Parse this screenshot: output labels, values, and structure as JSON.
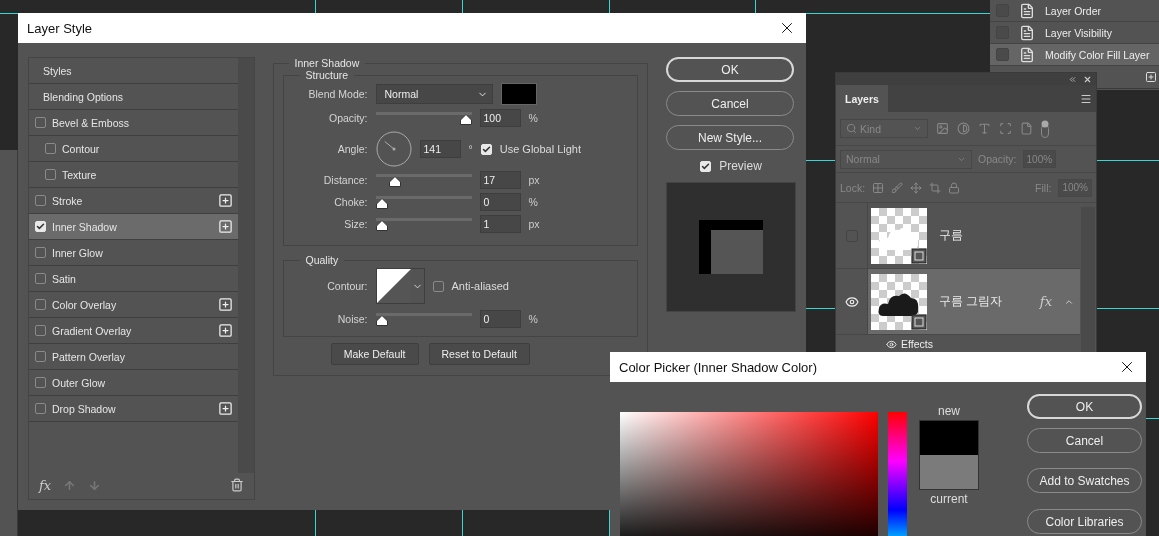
{
  "actions_panel": {
    "items": [
      {
        "label": "Layer Order",
        "checked": false,
        "selected": false
      },
      {
        "label": "Layer Visibility",
        "checked": false,
        "selected": false
      },
      {
        "label": "Modify Color Fill Layer",
        "checked": false,
        "selected": true
      }
    ]
  },
  "layer_style": {
    "title": "Layer Style",
    "styles": [
      {
        "label": "Styles",
        "kind": "header",
        "selected": false
      },
      {
        "label": "Blending Options",
        "kind": "header",
        "selected": false
      },
      {
        "label": "Bevel & Emboss",
        "kind": "effect",
        "checked": false,
        "selected": false,
        "addable": false,
        "children": [
          {
            "label": "Contour",
            "kind": "effect",
            "checked": false,
            "selected": false,
            "addable": false
          },
          {
            "label": "Texture",
            "kind": "effect",
            "checked": false,
            "selected": false,
            "addable": false
          }
        ]
      },
      {
        "label": "Stroke",
        "kind": "effect",
        "checked": false,
        "selected": false,
        "addable": true
      },
      {
        "label": "Inner Shadow",
        "kind": "effect",
        "checked": true,
        "selected": true,
        "addable": true
      },
      {
        "label": "Inner Glow",
        "kind": "effect",
        "checked": false,
        "selected": false,
        "addable": false
      },
      {
        "label": "Satin",
        "kind": "effect",
        "checked": false,
        "selected": false,
        "addable": false
      },
      {
        "label": "Color Overlay",
        "kind": "effect",
        "checked": false,
        "selected": false,
        "addable": true
      },
      {
        "label": "Gradient Overlay",
        "kind": "effect",
        "checked": false,
        "selected": false,
        "addable": true
      },
      {
        "label": "Pattern Overlay",
        "kind": "effect",
        "checked": false,
        "selected": false,
        "addable": false
      },
      {
        "label": "Outer Glow",
        "kind": "effect",
        "checked": false,
        "selected": false,
        "addable": false
      },
      {
        "label": "Drop Shadow",
        "kind": "effect",
        "checked": false,
        "selected": false,
        "addable": true
      }
    ],
    "section_title": "Inner Shadow",
    "structure": {
      "title": "Structure",
      "blend_mode": {
        "label": "Blend Mode:",
        "value": "Normal"
      },
      "opacity": {
        "label": "Opacity:",
        "level": 1,
        "value": "100",
        "unit": "%"
      },
      "angle": {
        "label": "Angle:",
        "value": "141",
        "unit": "°",
        "global_light": {
          "label": "Use Global Light",
          "checked": true
        }
      },
      "sliders": [
        {
          "label": "Distance:",
          "level": 0.16,
          "value": "17",
          "unit": "px"
        },
        {
          "label": "Choke:",
          "level": 0,
          "value": "0",
          "unit": "%"
        },
        {
          "label": "Size:",
          "level": 0.01,
          "value": "1",
          "unit": "px"
        }
      ]
    },
    "quality": {
      "title": "Quality",
      "contour_label": "Contour:",
      "anti_aliased": {
        "label": "Anti-aliased",
        "checked": false
      },
      "noise": {
        "label": "Noise:",
        "level": 0,
        "value": "0",
        "unit": "%"
      }
    },
    "footer_fx": "fx",
    "default_buttons": [
      "Make Default",
      "Reset to Default"
    ],
    "side_buttons": [
      {
        "label": "OK",
        "primary": true
      },
      {
        "label": "Cancel",
        "primary": false
      },
      {
        "label": "New Style...",
        "primary": false
      }
    ],
    "preview": {
      "label": "Preview",
      "checked": true
    }
  },
  "layers_panel": {
    "tab": "Layers",
    "kind_filter": "Kind",
    "blend_mode": "Normal",
    "opacity_label": "Opacity:",
    "opacity": "100%",
    "lock_label": "Lock:",
    "fill_label": "Fill:",
    "fill": "100%",
    "layers": [
      {
        "name": "구름",
        "visible": false,
        "selected": false,
        "kind": "light"
      },
      {
        "name": "구름 그림자",
        "visible": true,
        "selected": true,
        "kind": "dark",
        "fx": "fx",
        "effects": "Effects"
      }
    ]
  },
  "color_picker": {
    "title": "Color Picker (Inner Shadow Color)",
    "new_label": "new",
    "current_label": "current",
    "buttons": [
      {
        "label": "OK",
        "primary": true
      },
      {
        "label": "Cancel",
        "primary": false
      },
      {
        "label": "Add to Swatches",
        "primary": false
      },
      {
        "label": "Color Libraries",
        "primary": false
      }
    ]
  }
}
